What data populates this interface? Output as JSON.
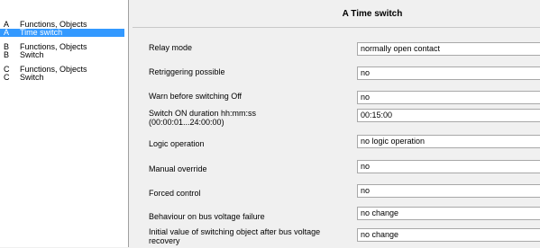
{
  "sidebar": {
    "groups": [
      {
        "items": [
          {
            "letter": "A",
            "label": "Functions, Objects",
            "selected": false
          },
          {
            "letter": "A",
            "label": "Time switch",
            "selected": true
          }
        ]
      },
      {
        "items": [
          {
            "letter": "B",
            "label": "Functions, Objects",
            "selected": false
          },
          {
            "letter": "B",
            "label": "Switch",
            "selected": false
          }
        ]
      },
      {
        "items": [
          {
            "letter": "C",
            "label": "Functions, Objects",
            "selected": false
          },
          {
            "letter": "C",
            "label": "Switch",
            "selected": false
          }
        ]
      }
    ]
  },
  "main": {
    "title": "A  Time switch",
    "rows": [
      {
        "label": "Relay mode",
        "control": "select",
        "value": "normally open contact"
      },
      {
        "label": "Retriggering possible",
        "control": "select",
        "value": "no"
      },
      {
        "label": "Warn before switching Off",
        "control": "select",
        "value": "no"
      },
      {
        "label": "Switch ON duration hh:mm:ss\n(00:00:01...24:00:00)",
        "control": "input",
        "value": "00:15:00"
      },
      {
        "label": "Logic operation",
        "control": "select",
        "value": "no logic operation"
      },
      {
        "label": "Manual override",
        "control": "select",
        "value": "no"
      },
      {
        "label": "Forced control",
        "control": "select",
        "value": "no"
      },
      {
        "label": "Behaviour on bus voltage failure",
        "control": "select",
        "value": "no change"
      },
      {
        "label": "Initial value of switching object after bus voltage recovery",
        "control": "select",
        "value": "no change"
      }
    ]
  }
}
